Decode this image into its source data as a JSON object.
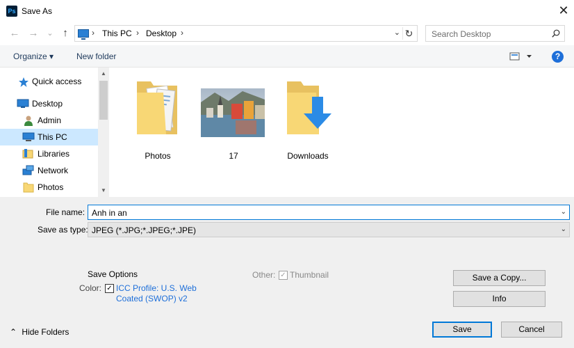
{
  "window": {
    "app_icon_label": "Ps",
    "title": "Save As",
    "close_glyph": "✕"
  },
  "navigation": {
    "back_glyph": "←",
    "forward_glyph": "→",
    "recent_glyph": "⌄",
    "up_glyph": "↑",
    "breadcrumb": [
      "This PC",
      "Desktop"
    ],
    "chevron": "›",
    "dropdown_glyph": "⌄",
    "refresh_glyph": "↻",
    "search_placeholder": "Search Desktop"
  },
  "command_bar": {
    "organize_label": "Organize ▾",
    "new_folder_label": "New folder",
    "view_icon": "view-options-icon",
    "help_label": "?"
  },
  "nav_pane": {
    "items": [
      {
        "label": "Quick access",
        "icon": "star-icon"
      },
      {
        "label": "Desktop",
        "icon": "desktop-icon"
      },
      {
        "label": "Admin",
        "icon": "user-icon"
      },
      {
        "label": "This PC",
        "icon": "computer-icon",
        "selected": true
      },
      {
        "label": "Libraries",
        "icon": "libraries-icon"
      },
      {
        "label": "Network",
        "icon": "network-icon"
      },
      {
        "label": "Photos",
        "icon": "folder-icon"
      }
    ],
    "scroll_up": "▲",
    "scroll_down": "▼"
  },
  "files": [
    {
      "label": "Photos",
      "type": "folder-with-docs"
    },
    {
      "label": "17",
      "type": "image-thumbnail"
    },
    {
      "label": "Downloads",
      "type": "downloads-folder"
    }
  ],
  "form": {
    "file_name_label": "File name:",
    "file_name_value": "Anh in an",
    "save_type_label": "Save as type:",
    "save_type_value": "JPEG (*.JPG;*.JPEG;*.JPE)",
    "dropdown_glyph": "⌄"
  },
  "save_options": {
    "title": "Save Options",
    "color_label": "Color:",
    "icc_line1": "ICC Profile:  U.S. Web",
    "icc_line2": "Coated (SWOP) v2",
    "icc_checked": true,
    "other_label": "Other:",
    "thumbnail_label": "Thumbnail",
    "thumbnail_checked": true,
    "check_glyph": "✓"
  },
  "buttons": {
    "save_copy": "Save a Copy...",
    "info": "Info",
    "save": "Save",
    "cancel": "Cancel",
    "hide_folders": "Hide Folders",
    "hide_folders_glyph": "⌃"
  },
  "colors": {
    "accent": "#0078d7",
    "selection": "#cce8ff",
    "folder": "#f8d775",
    "link": "#1e6fd9"
  }
}
